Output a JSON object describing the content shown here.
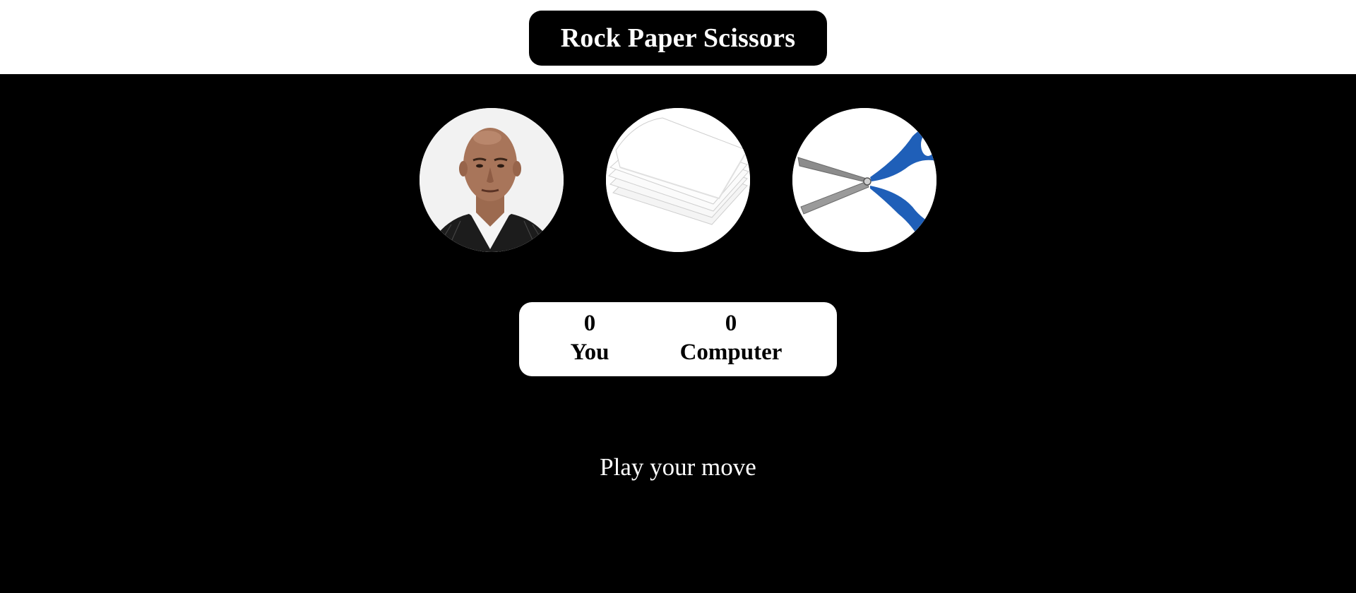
{
  "header": {
    "title": "Rock Paper Scissors"
  },
  "choices": [
    {
      "id": "rock",
      "icon": "rock-face-photo"
    },
    {
      "id": "paper",
      "icon": "paper-stack-photo"
    },
    {
      "id": "scissors",
      "icon": "scissors-photo"
    }
  ],
  "scoreboard": {
    "user": {
      "score": "0",
      "label": "You"
    },
    "computer": {
      "score": "0",
      "label": "Computer"
    }
  },
  "message": "Play your move",
  "colors": {
    "background": "#000000",
    "header_background": "#ffffff",
    "scissors_handle": "#1f5fb8"
  }
}
